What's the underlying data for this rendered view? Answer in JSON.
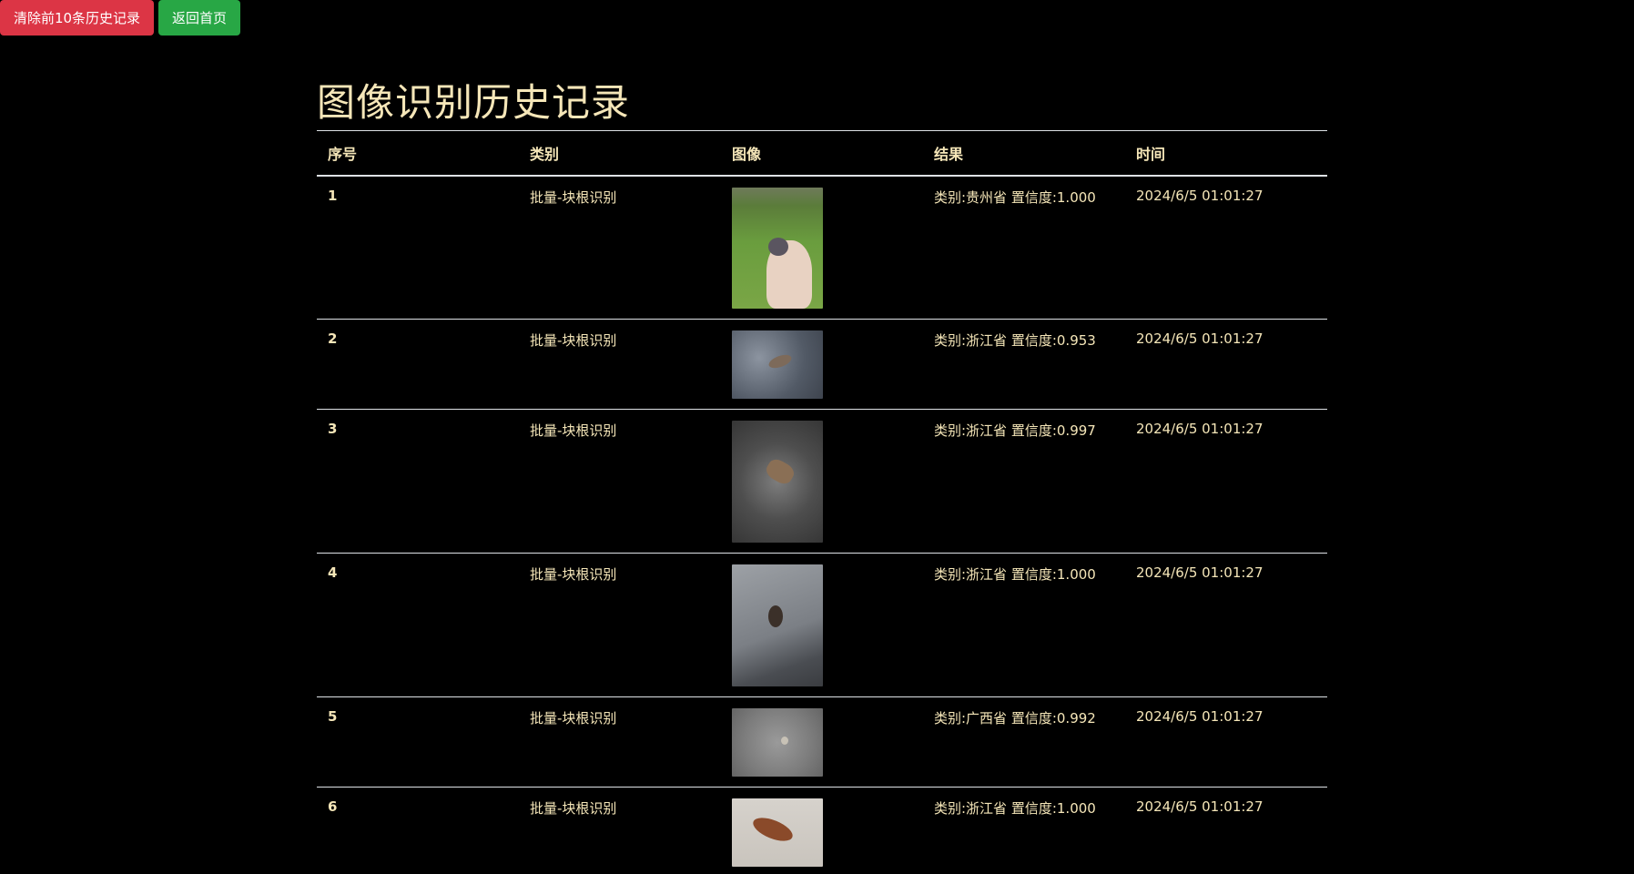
{
  "toolbar": {
    "clear_label": "清除前10条历史记录",
    "home_label": "返回首页",
    "colors": {
      "clear": "#dc3545",
      "home": "#28a745"
    }
  },
  "page": {
    "title": "图像识别历史记录",
    "text_color": "#f5e6b8",
    "background": "#000000"
  },
  "table": {
    "headers": [
      "序号",
      "类别",
      "图像",
      "结果",
      "时间"
    ],
    "rows": [
      {
        "index": "1",
        "category": "批量-块根识别",
        "image": "hand-holding-stone-on-grass",
        "result": "类别:贵州省 置信度:1.000",
        "time": "2024/6/5 01:01:27"
      },
      {
        "index": "2",
        "category": "批量-块根识别",
        "image": "object-on-asphalt",
        "result": "类别:浙江省 置信度:0.953",
        "time": "2024/6/5 01:01:27"
      },
      {
        "index": "3",
        "category": "批量-块根识别",
        "image": "object-on-gravel",
        "result": "类别:浙江省 置信度:0.997",
        "time": "2024/6/5 01:01:27"
      },
      {
        "index": "4",
        "category": "批量-块根识别",
        "image": "object-on-concrete",
        "result": "类别:浙江省 置信度:1.000",
        "time": "2024/6/5 01:01:27"
      },
      {
        "index": "5",
        "category": "批量-块根识别",
        "image": "small-object-on-asphalt",
        "result": "类别:广西省 置信度:0.992",
        "time": "2024/6/5 01:01:27"
      },
      {
        "index": "6",
        "category": "批量-块根识别",
        "image": "root-on-white-surface",
        "result": "类别:浙江省 置信度:1.000",
        "time": "2024/6/5 01:01:27"
      }
    ]
  }
}
